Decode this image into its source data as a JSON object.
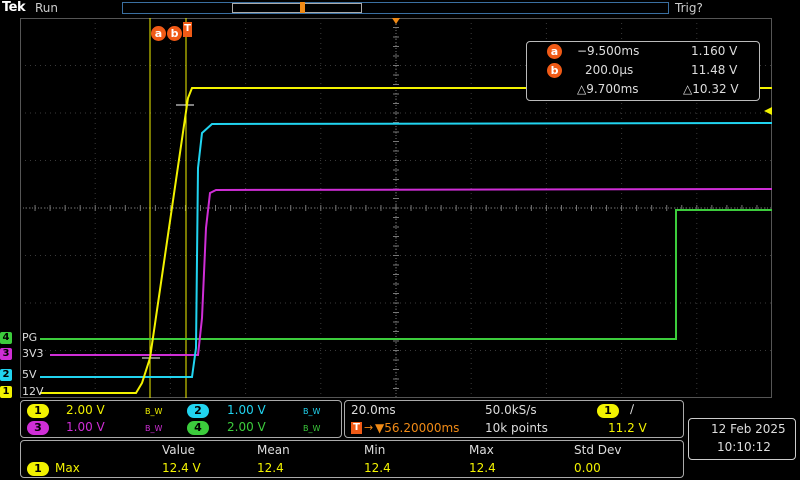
{
  "header": {
    "brand": "Tek",
    "run_state": "Run",
    "trigger_state": "Trig?"
  },
  "colors": {
    "ch1": "#f2f200",
    "ch2": "#21d4f0",
    "ch3": "#cf2ed6",
    "ch4": "#3ccc3c",
    "cursor_badge": "#f05a16",
    "grid": "#3a3a3a",
    "record_bar": "#3a6fa0"
  },
  "cursor_tags": {
    "a": "a",
    "b": "b",
    "trigger": "T"
  },
  "cursor_readout": {
    "a_time": "−9.500ms",
    "a_volt": "1.160 V",
    "b_time": "200.0μs",
    "b_volt": "11.48 V",
    "delta_time": "△9.700ms",
    "delta_volt": "△10.32 V"
  },
  "channel_markers": [
    {
      "num": "4",
      "label": "PG"
    },
    {
      "num": "3",
      "label": "3V3"
    },
    {
      "num": "2",
      "label": "5V"
    },
    {
      "num": "1",
      "label": "12V"
    }
  ],
  "vertical": {
    "ch1": {
      "num": "1",
      "scale": "2.00 V",
      "bw": "B_W"
    },
    "ch2": {
      "num": "2",
      "scale": "1.00 V",
      "bw": "B_W"
    },
    "ch3": {
      "num": "3",
      "scale": "1.00 V",
      "bw": "B_W"
    },
    "ch4": {
      "num": "4",
      "scale": "2.00 V",
      "bw": "B_W"
    }
  },
  "horizontal": {
    "scale": "20.0ms",
    "sample_rate": "50.0kS/s",
    "trigger_pos": "▼56.20000ms",
    "record_length": "10k points"
  },
  "trigger": {
    "source": "1",
    "slope": "∕",
    "level": "11.2 V"
  },
  "datetime": {
    "date": "12 Feb  2025",
    "time": "10:10:12"
  },
  "measurements": {
    "headers": [
      "Value",
      "Mean",
      "Min",
      "Max",
      "Std Dev"
    ],
    "rows": [
      {
        "source": "1",
        "name": "Max",
        "value": "12.4 V",
        "mean": "12.4",
        "min": "12.4",
        "max": "12.4",
        "std_dev": "0.00"
      }
    ]
  }
}
